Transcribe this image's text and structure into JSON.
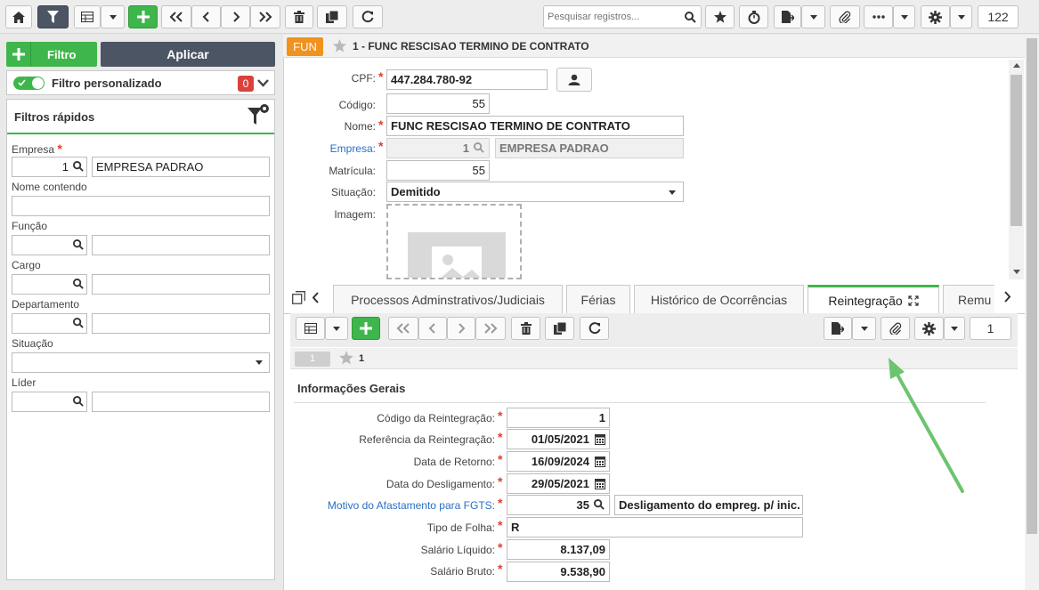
{
  "toolbar": {
    "search_placeholder": "Pesquisar registros...",
    "record_count": "122"
  },
  "left": {
    "add_filter_label": "Filtro",
    "apply_label": "Aplicar",
    "custom_filter_label": "Filtro personalizado",
    "custom_filter_count": "0",
    "quick_filters_title": "Filtros rápidos",
    "fields": {
      "empresa_label": "Empresa",
      "empresa_code": "1",
      "empresa_name": "EMPRESA PADRAO",
      "nome_label": "Nome contendo",
      "funcao_label": "Função",
      "cargo_label": "Cargo",
      "departamento_label": "Departamento",
      "situacao_label": "Situação",
      "lider_label": "Líder"
    }
  },
  "record": {
    "badge": "FUN",
    "title": "1 - FUNC RESCISAO TERMINO DE CONTRATO",
    "cpf_label": "CPF:",
    "cpf": "447.284.780-92",
    "codigo_label": "Código:",
    "codigo": "55",
    "nome_label": "Nome:",
    "nome": "FUNC RESCISAO TERMINO DE CONTRATO",
    "empresa_label": "Empresa:",
    "empresa_code": "1",
    "empresa_name": "EMPRESA PADRAO",
    "matricula_label": "Matrícula:",
    "matricula": "55",
    "situacao_label": "Situação:",
    "situacao": "Demitido",
    "imagem_label": "Imagem:"
  },
  "tabs": [
    {
      "label": "Processos Adminstrativos/Judiciais"
    },
    {
      "label": "Férias"
    },
    {
      "label": "Histórico de Ocorrências"
    },
    {
      "label": "Reintegração"
    },
    {
      "label": "Remu"
    }
  ],
  "sub": {
    "page_number": "1",
    "row_badge": "1",
    "row_id": "1",
    "section_title": "Informações Gerais",
    "fields": [
      {
        "label": "Código da Reintegração:",
        "value": "1"
      },
      {
        "label": "Referência da Reintegração:",
        "value": "01/05/2021"
      },
      {
        "label": "Data de Retorno:",
        "value": "16/09/2024"
      },
      {
        "label": "Data do Desligamento:",
        "value": "29/05/2021"
      },
      {
        "label": "Motivo do Afastamento para FGTS:",
        "value": "35",
        "desc": "Desligamento do empreg. p/ inic."
      },
      {
        "label": "Tipo de Folha:",
        "value": "R"
      },
      {
        "label": "Salário Líquido:",
        "value": "8.137,09"
      },
      {
        "label": "Salário Bruto:",
        "value": "9.538,90"
      }
    ]
  },
  "colors": {
    "accent_green": "#3fb64b",
    "badge_orange": "#f0921e",
    "link_blue": "#2a6fc6",
    "arrow_green": "#6cc46e"
  }
}
